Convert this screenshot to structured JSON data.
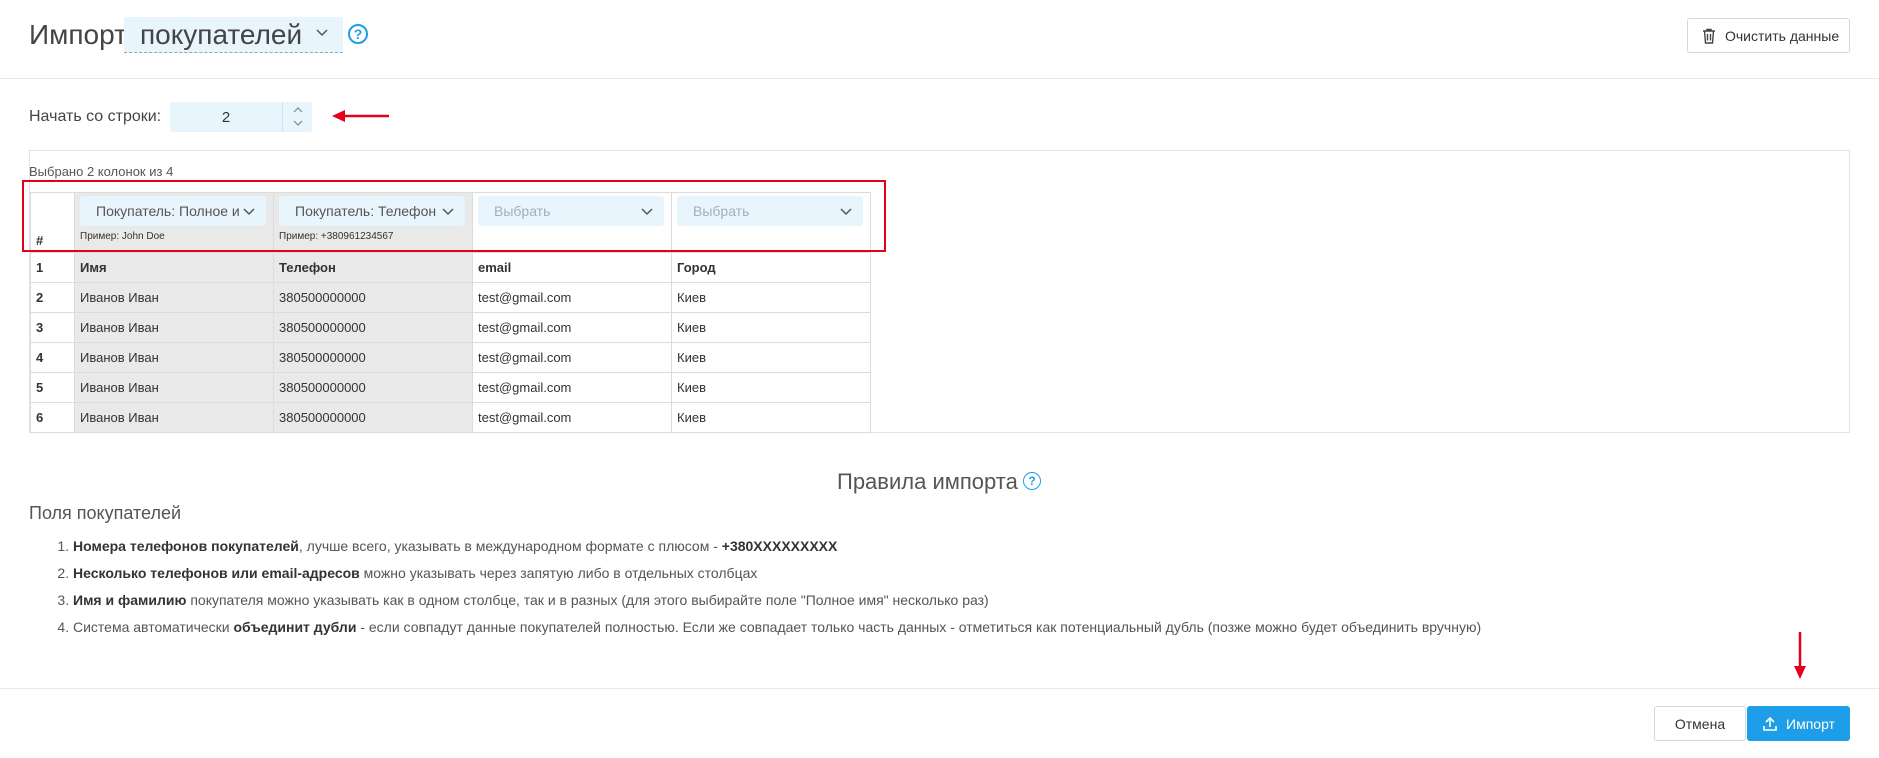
{
  "header": {
    "title": "Импорт",
    "entity_select": "покупателей",
    "clear_button": "Очистить данные"
  },
  "start_row": {
    "label": "Начать со строки:",
    "value": "2"
  },
  "table": {
    "selected_info": "Выбрано 2 колонок из 4",
    "hash": "#",
    "columns": [
      {
        "select": "Покупатель: Полное и",
        "example": "Пример: John Doe",
        "mapped": true
      },
      {
        "select": "Покупатель: Телефон",
        "example": "Пример: +380961234567",
        "mapped": true
      },
      {
        "select": "Выбрать",
        "example": "",
        "mapped": false
      },
      {
        "select": "Выбрать",
        "example": "",
        "mapped": false
      }
    ],
    "rows": [
      {
        "n": "1",
        "cells": [
          "Имя",
          "Телефон",
          "email",
          "Город"
        ]
      },
      {
        "n": "2",
        "cells": [
          "Иванов Иван",
          "380500000000",
          "test@gmail.com",
          "Киев"
        ]
      },
      {
        "n": "3",
        "cells": [
          "Иванов Иван",
          "380500000000",
          "test@gmail.com",
          "Киев"
        ]
      },
      {
        "n": "4",
        "cells": [
          "Иванов Иван",
          "380500000000",
          "test@gmail.com",
          "Киев"
        ]
      },
      {
        "n": "5",
        "cells": [
          "Иванов Иван",
          "380500000000",
          "test@gmail.com",
          "Киев"
        ]
      },
      {
        "n": "6",
        "cells": [
          "Иванов Иван",
          "380500000000",
          "test@gmail.com",
          "Киев"
        ]
      }
    ]
  },
  "rules": {
    "title": "Правила импорта",
    "fields_title": "Поля покупателей",
    "items": [
      {
        "pre": "",
        "bold": "Номера телефонов покупателей",
        "post": ", лучше всего, указывать в международном формате с плюсом - ",
        "bold2": "+380XXXXXXXXX"
      },
      {
        "pre": "",
        "bold": "Несколько телефонов или email-адресов",
        "post": " можно указывать через запятую либо в отдельных столбцах",
        "bold2": ""
      },
      {
        "pre": "",
        "bold": "Имя и фамилию",
        "post": " покупателя можно указывать как в одном столбце, так и в разных (для этого выбирайте поле \"Полное имя\" несколько раз)",
        "bold2": ""
      },
      {
        "pre": "Система автоматически ",
        "bold": "объединит дубли",
        "post": " - если совпадут данные покупателей полностью. Если же совпадает только часть данных - отметиться как потенциальный дубль (позже можно будет объединить вручную)",
        "bold2": ""
      }
    ]
  },
  "footer": {
    "cancel_button": "Отмена",
    "import_button": "Импорт"
  },
  "colors": {
    "accent": "#1e9ee8",
    "highlight_red": "#e3001b",
    "input_bg": "#e9f5fc",
    "mapped_col_bg": "#e9e9e9"
  },
  "icons": [
    "chevron-down-icon",
    "help-icon",
    "trash-icon",
    "upload-icon",
    "spin-up-icon",
    "spin-down-icon"
  ]
}
